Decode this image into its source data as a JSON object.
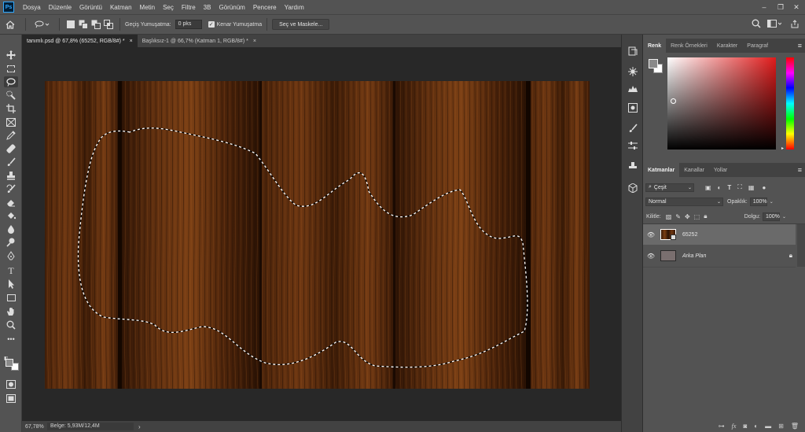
{
  "app": {
    "logo": "Ps"
  },
  "menu": [
    "Dosya",
    "Düzenle",
    "Görüntü",
    "Katman",
    "Metin",
    "Seç",
    "Filtre",
    "3B",
    "Görünüm",
    "Pencere",
    "Yardım"
  ],
  "window_controls": [
    "–",
    "❐",
    "✕"
  ],
  "options": {
    "feather_label": "Geçiş Yumuşatma:",
    "feather_value": "0 pks",
    "antialias_label": "Kenar Yumuşatma",
    "antialias_checked": true,
    "mask_button": "Seç ve Maskele..."
  },
  "tabs": [
    {
      "label": "tanımlı.psd @ 67,8% (65252, RGB/8#) *",
      "active": true,
      "close": "×"
    },
    {
      "label": "Başlıksız-1 @ 66,7% (Katman 1, RGB/8#) *",
      "active": false,
      "close": "×"
    }
  ],
  "status": {
    "zoom": "67,78%",
    "info": "Belge: 5,93M/12,4M",
    "arrow": "›"
  },
  "color_panel": {
    "tabs": [
      "Renk",
      "Renk Örnekleri",
      "Karakter",
      "Paragraf"
    ],
    "active_tab": "Renk",
    "hue_color": "#e01b1b",
    "fg_color": "#8a8a8a",
    "bg_color": "#ffffff"
  },
  "layers_panel": {
    "tabs": [
      "Katmanlar",
      "Kanallar",
      "Yollar"
    ],
    "active_tab": "Katmanlar",
    "filter_kind": "Çeşit",
    "blend_mode": "Normal",
    "opacity_label": "Opaklık:",
    "opacity_value": "100%",
    "lock_label": "Kilitle:",
    "fill_label": "Dolgu:",
    "fill_value": "100%",
    "layers": [
      {
        "name": "65252",
        "selected": true,
        "italic": false,
        "locked": false,
        "thumb": "wood"
      },
      {
        "name": "Arka Plan",
        "selected": false,
        "italic": true,
        "locked": true,
        "thumb": "#7a6f6f"
      }
    ],
    "footer_icons": [
      "link-icon",
      "fx-icon",
      "mask-icon",
      "adjustment-icon",
      "group-icon",
      "new-layer-icon",
      "delete-icon"
    ]
  },
  "colors": {
    "chrome": "#535353",
    "dark_chrome": "#424242",
    "canvas_bg": "#282828",
    "wood_dark": "#2a1407",
    "wood_light": "#7a3e12"
  }
}
